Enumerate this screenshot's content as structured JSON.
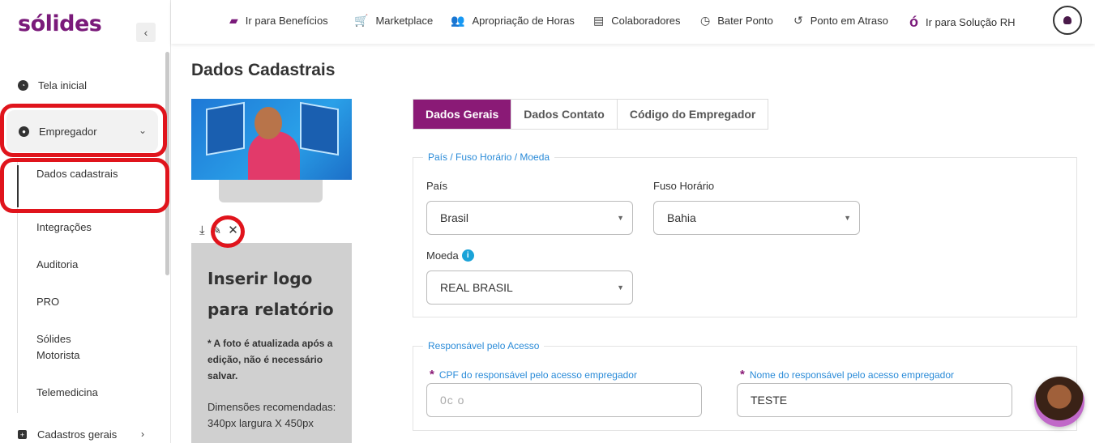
{
  "brand": {
    "logo_text": "sólides"
  },
  "sidebar": {
    "collapse_icon": "chevron-left-icon",
    "items": [
      {
        "label": "Tela inicial",
        "icon": "dashboard-icon"
      },
      {
        "label": "Empregador",
        "icon": "user-circle-icon"
      }
    ],
    "submenu": [
      {
        "label": "Dados cadastrais",
        "active": true
      },
      {
        "label": "Integrações"
      },
      {
        "label": "Auditoria"
      },
      {
        "label": "PRO"
      },
      {
        "label": "Sólides Motorista"
      },
      {
        "label": "Telemedicina"
      }
    ],
    "bottom_item": {
      "label": "Cadastros gerais",
      "icon": "plus-square-icon"
    }
  },
  "topbar": {
    "items": [
      {
        "label": "Ir para Benefícios",
        "icon": "wallet-icon"
      },
      {
        "label": "Marketplace",
        "icon": "cart-icon"
      },
      {
        "label": "Apropriação de Horas",
        "icon": "users-icon"
      },
      {
        "label": "Colaboradores",
        "icon": "book-icon"
      },
      {
        "label": "Bater Ponto",
        "icon": "clock-icon"
      },
      {
        "label": "Ponto em Atraso",
        "icon": "history-icon"
      },
      {
        "label": "Ir para Solução RH",
        "icon": "solides-icon"
      }
    ],
    "avatar_icon": "user-icon"
  },
  "page": {
    "title": "Dados Cadastrais"
  },
  "logo_card": {
    "heading": "Inserir logo para relatório",
    "note": "* A foto é atualizada após a edição, não é necessário salvar.",
    "dimensions": "Dimensões recomendadas: 340px largura X 450px"
  },
  "tabs": [
    {
      "label": "Dados Gerais",
      "active": true
    },
    {
      "label": "Dados Contato"
    },
    {
      "label": "Código do Empregador"
    }
  ],
  "section_locale": {
    "legend": "País / Fuso Horário / Moeda",
    "pais_label": "País",
    "pais_value": "Brasil",
    "fuso_label": "Fuso Horário",
    "fuso_value": "Bahia",
    "moeda_label": "Moeda",
    "moeda_value": "REAL BRASIL"
  },
  "section_responsavel": {
    "legend": "Responsável pelo Acesso",
    "cpf_label": "CPF do responsável pelo acesso empregador",
    "cpf_value": "0c                  o",
    "nome_label": "Nome do responsável pelo acesso empregador",
    "nome_value": "TESTE"
  },
  "colors": {
    "brand": "#7a1a7a",
    "tab_active": "#8a1a76",
    "legend": "#2a8bd8",
    "highlight": "#e0141c"
  }
}
